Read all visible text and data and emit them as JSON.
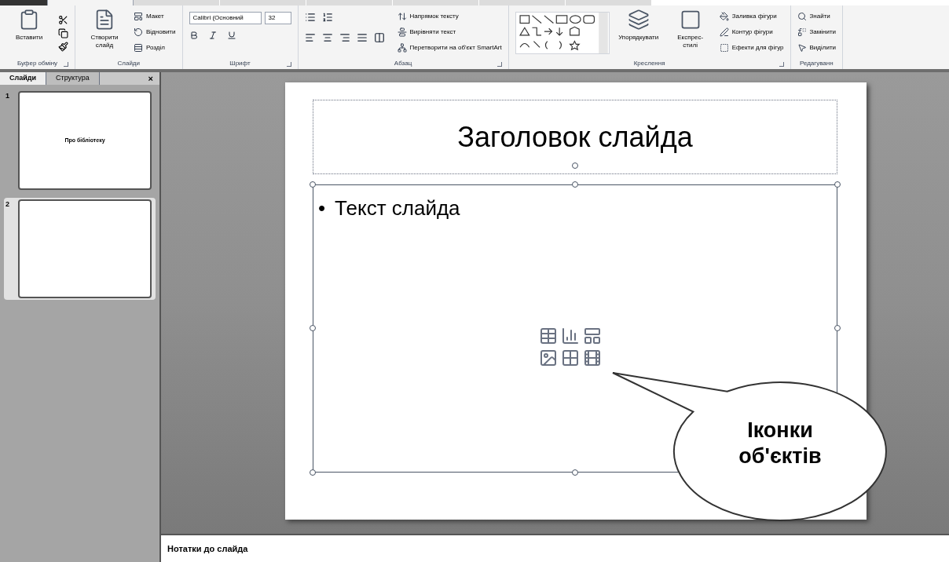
{
  "ribbon": {
    "tabs": [
      {
        "selected": false
      },
      {
        "selected": true
      },
      {
        "selected": false
      },
      {
        "selected": false
      },
      {
        "selected": false
      },
      {
        "selected": false
      },
      {
        "selected": false
      },
      {
        "selected": false
      }
    ],
    "groups": [
      {
        "label": "Буфер обміну",
        "launcher": true,
        "items": [
          {
            "kind": "large",
            "label": "Вставити"
          },
          {
            "kind": "tools"
          }
        ]
      },
      {
        "label": "Слайди",
        "launcher": false,
        "items": [
          {
            "kind": "large",
            "label": "Створити слайд"
          },
          {
            "kind": "small",
            "label": "Макет"
          },
          {
            "kind": "small",
            "label": "Відновити"
          },
          {
            "kind": "small",
            "label": "Розділ"
          }
        ]
      },
      {
        "label": "Шрифт",
        "launcher": true,
        "items": [
          {
            "kind": "font",
            "font": "Calibri (Основний",
            "size": "32"
          }
        ]
      },
      {
        "label": "Абзац",
        "launcher": true,
        "items": [
          {
            "kind": "para"
          },
          {
            "kind": "small",
            "label": "Напрямок тексту"
          },
          {
            "kind": "small",
            "label": "Вирівняти текст"
          },
          {
            "kind": "small",
            "label": "Перетворити на об'єкт SmartArt"
          }
        ]
      },
      {
        "label": "Креслення",
        "launcher": true,
        "items": [
          {
            "kind": "shapes"
          },
          {
            "kind": "large",
            "label": "Упорядкувати"
          },
          {
            "kind": "large",
            "label": "Експрес-стилі"
          },
          {
            "kind": "small",
            "label": "Заливка фігури"
          },
          {
            "kind": "small",
            "label": "Контур фігури"
          },
          {
            "kind": "small",
            "label": "Ефекти для фігур"
          }
        ]
      },
      {
        "label": "Редагуванн",
        "launcher": false,
        "items": [
          {
            "kind": "small",
            "label": "Знайти"
          },
          {
            "kind": "small",
            "label": "Замінити"
          },
          {
            "kind": "small",
            "label": "Виділити"
          }
        ]
      }
    ]
  },
  "panel": {
    "tabs": [
      {
        "label": "Слайди",
        "selected": true
      },
      {
        "label": "Структура",
        "selected": false
      }
    ],
    "close": "×",
    "thumbnails": [
      {
        "number": "1",
        "text": "Про бібліотеку",
        "selected": false
      },
      {
        "number": "2",
        "selected": true
      }
    ]
  },
  "slide": {
    "title": "Заголовок слайда",
    "bullet": "•",
    "body": "Текст слайда"
  },
  "callout": {
    "lines": [
      "Іконки",
      "об'єктів"
    ]
  },
  "notes": {
    "placeholder": "Нотатки до слайда"
  }
}
